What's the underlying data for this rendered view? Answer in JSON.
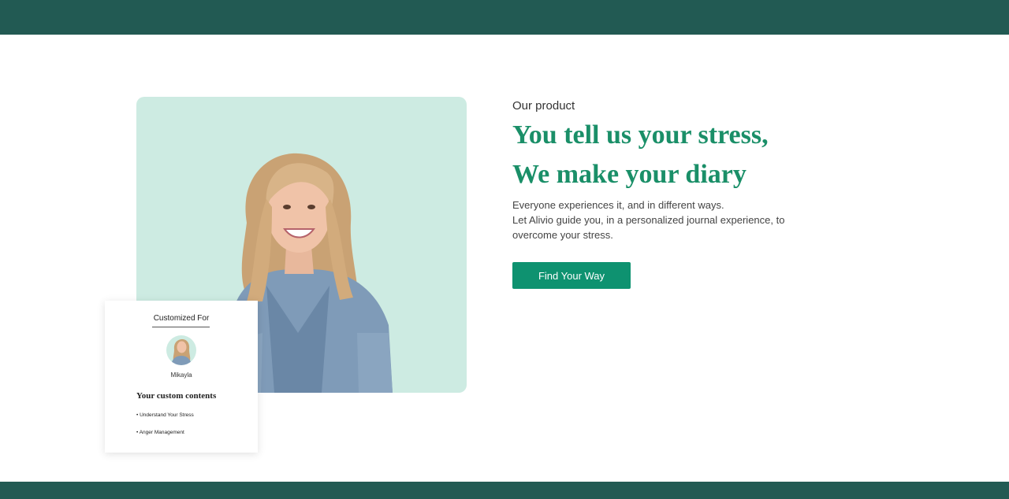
{
  "colors": {
    "header_bar": "#225a53",
    "footer_bar": "#225a53",
    "image_background": "#cdebe2",
    "headline": "#1a8f68",
    "button": "#0e9270"
  },
  "product": {
    "eyebrow": "Our product",
    "headline_line1": "You tell us your stress,",
    "headline_line2": "We make your diary",
    "description_line1": "Everyone experiences it, and in different ways.",
    "description_line2": "Let Alivio guide you, in a personalized journal experience, to",
    "description_line3": "overcome your stress.",
    "cta_label": "Find Your Way"
  },
  "card": {
    "title": "Customized For",
    "name": "Mikayla",
    "heading": "Your custom contents",
    "items": [
      "• Understand Your Stress",
      "• Anger Management"
    ]
  }
}
